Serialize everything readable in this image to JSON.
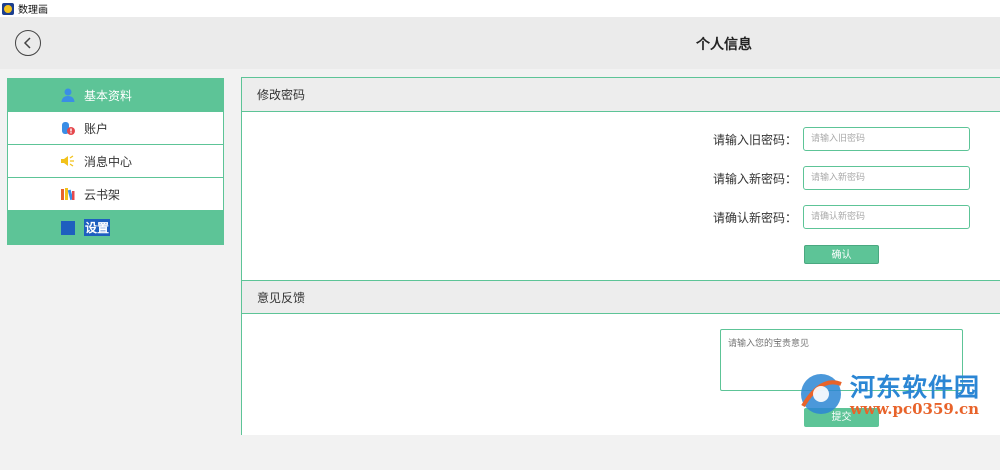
{
  "app": {
    "title": "数理画"
  },
  "header": {
    "title": "个人信息"
  },
  "sidebar": {
    "items": [
      {
        "label": "基本资料",
        "icon": "user-icon"
      },
      {
        "label": "账户",
        "icon": "coins-icon"
      },
      {
        "label": "消息中心",
        "icon": "speaker-icon"
      },
      {
        "label": "云书架",
        "icon": "bookshelf-icon"
      },
      {
        "label": "设置",
        "icon": "settings-square-icon"
      }
    ]
  },
  "password": {
    "section_title": "修改密码",
    "old_label": "请输入旧密码：",
    "old_placeholder": "请输入旧密码",
    "new_label": "请输入新密码：",
    "new_placeholder": "请输入新密码",
    "confirm_label": "请确认新密码：",
    "confirm_placeholder": "请确认新密码",
    "confirm_button": "确认"
  },
  "feedback": {
    "section_title": "意见反馈",
    "placeholder": "请输入您的宝贵意见",
    "submit_button": "提交"
  },
  "watermark": {
    "name": "河东软件园",
    "url": "www.pc0359.cn"
  },
  "colors": {
    "accent": "#5dc497",
    "selection": "#1e5fbf",
    "watermark_blue": "#2b86d4",
    "watermark_orange": "#e8632a"
  }
}
